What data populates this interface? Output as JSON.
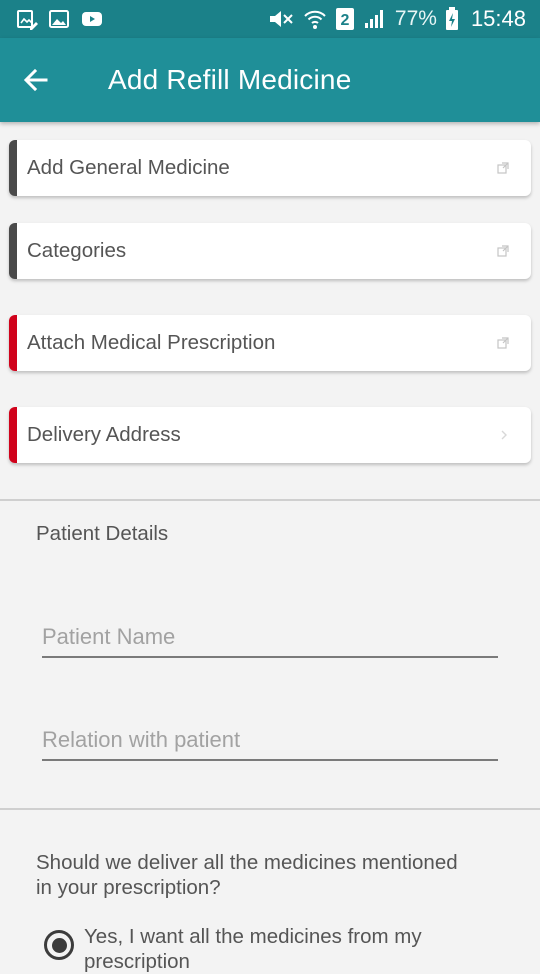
{
  "status_bar": {
    "battery": "77%",
    "time": "15:48",
    "sim_slot": "2",
    "icons": [
      "image-edit-icon",
      "gallery-icon",
      "youtube-icon",
      "mute-icon",
      "wifi-icon",
      "sim-2-icon",
      "signal-icon",
      "battery-charging-icon"
    ]
  },
  "app_bar": {
    "title": "Add Refill Medicine",
    "back_icon": "arrow-left-icon"
  },
  "cards": [
    {
      "label": "Add General Medicine",
      "accent": "#4a4a4a",
      "trail_icon": "open-link-icon"
    },
    {
      "label": "Categories",
      "accent": "#4a4a4a",
      "trail_icon": "open-link-icon"
    },
    {
      "label": "Attach Medical Prescription",
      "accent": "#d0021b",
      "trail_icon": "open-link-icon"
    },
    {
      "label": "Delivery Address",
      "accent": "#d0021b",
      "trail_icon": "chevron-right-icon"
    }
  ],
  "patient_details": {
    "title": "Patient Details",
    "name_placeholder": "Patient Name",
    "relation_placeholder": "Relation with patient"
  },
  "delivery_question": {
    "text": "Should we deliver all the medicines mentioned in your prescription?",
    "option_yes": "Yes, I want all the medicines from my prescription"
  },
  "colors": {
    "status_bar": "#1b8189",
    "app_bar": "#1f8f98",
    "background": "#f3f3f3",
    "required_accent": "#d0021b"
  }
}
